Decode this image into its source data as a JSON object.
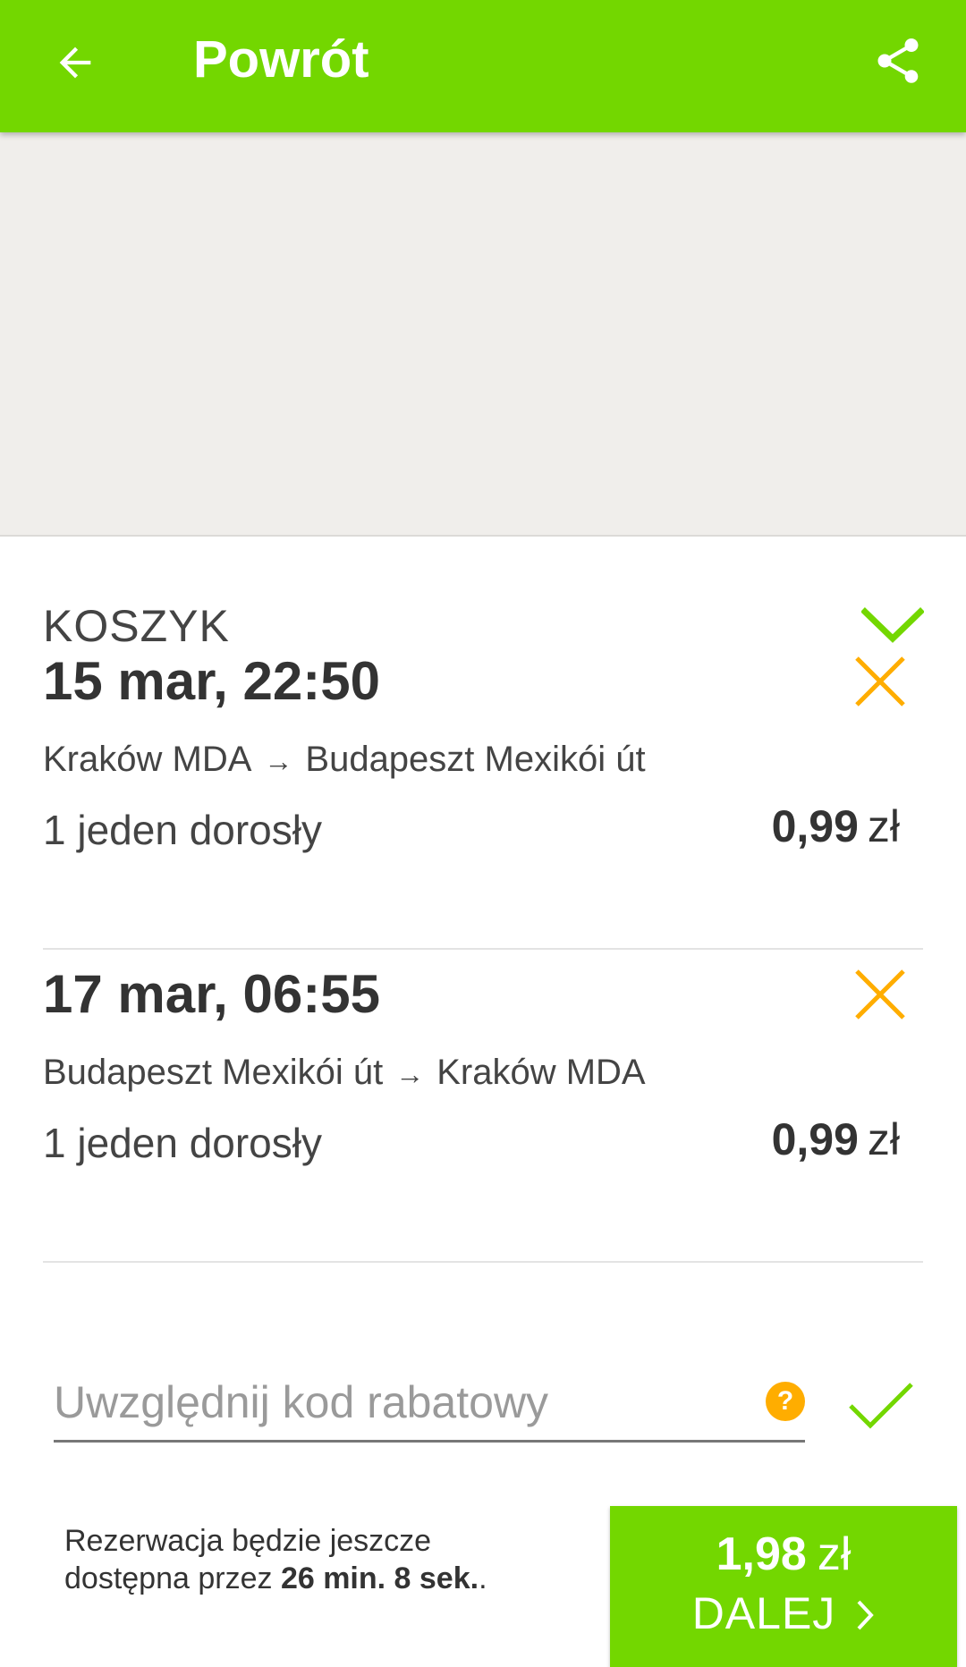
{
  "appbar": {
    "title": "Powrót",
    "back_icon": "arrow-left-icon",
    "share_icon": "share-icon",
    "background": "#73d700"
  },
  "cart": {
    "title": "KOSZYK",
    "toggle_icon": "chevron-down-icon",
    "trips": [
      {
        "date": "15 mar, 22:50",
        "from": "Kraków MDA",
        "arrow": "→",
        "to": "Budapeszt Mexikói út",
        "passengers": "1 jeden dorosły",
        "price": "0,99",
        "currency": "zł",
        "remove_icon": "close-icon"
      },
      {
        "date": "17 mar, 06:55",
        "from": "Budapeszt Mexikói út",
        "arrow": "→",
        "to": "Kraków MDA",
        "passengers": "1 jeden dorosły",
        "price": "0,99",
        "currency": "zł",
        "remove_icon": "close-icon"
      }
    ]
  },
  "discount": {
    "value": "",
    "placeholder": "Uwzględnij kod rabatowy",
    "help_icon": "help-icon",
    "help_glyph": "?",
    "apply_icon": "check-icon"
  },
  "footer": {
    "reservation_line1": "Rezerwacja będzie jeszcze",
    "reservation_line2_prefix": "dostępna przez ",
    "reservation_time": "26 min. 8 sek.",
    "reservation_suffix": ".",
    "total": "1,98",
    "currency": "zł",
    "next_label": "DALEJ",
    "next_icon": "chevron-right-icon"
  },
  "colors": {
    "brand_green": "#73d700",
    "remove_orange": "#ffad00",
    "background_gray": "#f0eeeb"
  }
}
